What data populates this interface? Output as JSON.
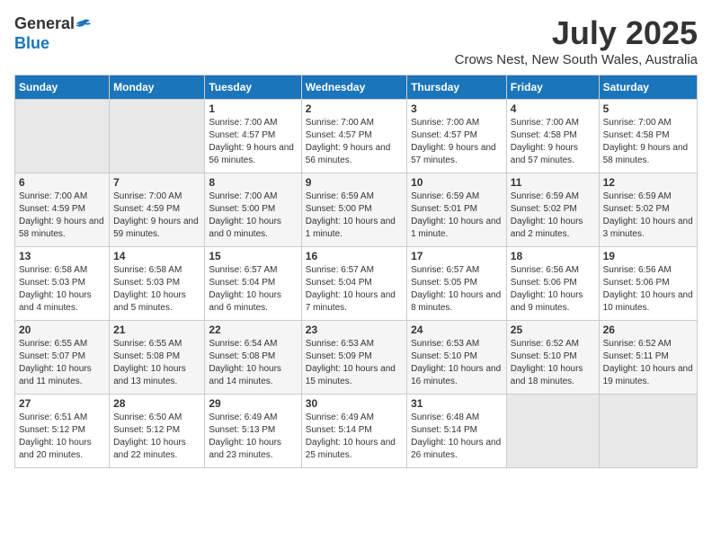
{
  "header": {
    "logo_line1": "General",
    "logo_line2": "Blue",
    "month_year": "July 2025",
    "location": "Crows Nest, New South Wales, Australia"
  },
  "days_of_week": [
    "Sunday",
    "Monday",
    "Tuesday",
    "Wednesday",
    "Thursday",
    "Friday",
    "Saturday"
  ],
  "weeks": [
    [
      {
        "day": "",
        "empty": true
      },
      {
        "day": "",
        "empty": true
      },
      {
        "day": "1",
        "sunrise": "7:00 AM",
        "sunset": "4:57 PM",
        "daylight": "9 hours and 56 minutes."
      },
      {
        "day": "2",
        "sunrise": "7:00 AM",
        "sunset": "4:57 PM",
        "daylight": "9 hours and 56 minutes."
      },
      {
        "day": "3",
        "sunrise": "7:00 AM",
        "sunset": "4:57 PM",
        "daylight": "9 hours and 57 minutes."
      },
      {
        "day": "4",
        "sunrise": "7:00 AM",
        "sunset": "4:58 PM",
        "daylight": "9 hours and 57 minutes."
      },
      {
        "day": "5",
        "sunrise": "7:00 AM",
        "sunset": "4:58 PM",
        "daylight": "9 hours and 58 minutes."
      }
    ],
    [
      {
        "day": "6",
        "sunrise": "7:00 AM",
        "sunset": "4:59 PM",
        "daylight": "9 hours and 58 minutes."
      },
      {
        "day": "7",
        "sunrise": "7:00 AM",
        "sunset": "4:59 PM",
        "daylight": "9 hours and 59 minutes."
      },
      {
        "day": "8",
        "sunrise": "7:00 AM",
        "sunset": "5:00 PM",
        "daylight": "10 hours and 0 minutes."
      },
      {
        "day": "9",
        "sunrise": "6:59 AM",
        "sunset": "5:00 PM",
        "daylight": "10 hours and 1 minute."
      },
      {
        "day": "10",
        "sunrise": "6:59 AM",
        "sunset": "5:01 PM",
        "daylight": "10 hours and 1 minute."
      },
      {
        "day": "11",
        "sunrise": "6:59 AM",
        "sunset": "5:02 PM",
        "daylight": "10 hours and 2 minutes."
      },
      {
        "day": "12",
        "sunrise": "6:59 AM",
        "sunset": "5:02 PM",
        "daylight": "10 hours and 3 minutes."
      }
    ],
    [
      {
        "day": "13",
        "sunrise": "6:58 AM",
        "sunset": "5:03 PM",
        "daylight": "10 hours and 4 minutes."
      },
      {
        "day": "14",
        "sunrise": "6:58 AM",
        "sunset": "5:03 PM",
        "daylight": "10 hours and 5 minutes."
      },
      {
        "day": "15",
        "sunrise": "6:57 AM",
        "sunset": "5:04 PM",
        "daylight": "10 hours and 6 minutes."
      },
      {
        "day": "16",
        "sunrise": "6:57 AM",
        "sunset": "5:04 PM",
        "daylight": "10 hours and 7 minutes."
      },
      {
        "day": "17",
        "sunrise": "6:57 AM",
        "sunset": "5:05 PM",
        "daylight": "10 hours and 8 minutes."
      },
      {
        "day": "18",
        "sunrise": "6:56 AM",
        "sunset": "5:06 PM",
        "daylight": "10 hours and 9 minutes."
      },
      {
        "day": "19",
        "sunrise": "6:56 AM",
        "sunset": "5:06 PM",
        "daylight": "10 hours and 10 minutes."
      }
    ],
    [
      {
        "day": "20",
        "sunrise": "6:55 AM",
        "sunset": "5:07 PM",
        "daylight": "10 hours and 11 minutes."
      },
      {
        "day": "21",
        "sunrise": "6:55 AM",
        "sunset": "5:08 PM",
        "daylight": "10 hours and 13 minutes."
      },
      {
        "day": "22",
        "sunrise": "6:54 AM",
        "sunset": "5:08 PM",
        "daylight": "10 hours and 14 minutes."
      },
      {
        "day": "23",
        "sunrise": "6:53 AM",
        "sunset": "5:09 PM",
        "daylight": "10 hours and 15 minutes."
      },
      {
        "day": "24",
        "sunrise": "6:53 AM",
        "sunset": "5:10 PM",
        "daylight": "10 hours and 16 minutes."
      },
      {
        "day": "25",
        "sunrise": "6:52 AM",
        "sunset": "5:10 PM",
        "daylight": "10 hours and 18 minutes."
      },
      {
        "day": "26",
        "sunrise": "6:52 AM",
        "sunset": "5:11 PM",
        "daylight": "10 hours and 19 minutes."
      }
    ],
    [
      {
        "day": "27",
        "sunrise": "6:51 AM",
        "sunset": "5:12 PM",
        "daylight": "10 hours and 20 minutes."
      },
      {
        "day": "28",
        "sunrise": "6:50 AM",
        "sunset": "5:12 PM",
        "daylight": "10 hours and 22 minutes."
      },
      {
        "day": "29",
        "sunrise": "6:49 AM",
        "sunset": "5:13 PM",
        "daylight": "10 hours and 23 minutes."
      },
      {
        "day": "30",
        "sunrise": "6:49 AM",
        "sunset": "5:14 PM",
        "daylight": "10 hours and 25 minutes."
      },
      {
        "day": "31",
        "sunrise": "6:48 AM",
        "sunset": "5:14 PM",
        "daylight": "10 hours and 26 minutes."
      },
      {
        "day": "",
        "empty": true
      },
      {
        "day": "",
        "empty": true
      }
    ]
  ],
  "labels": {
    "sunrise": "Sunrise:",
    "sunset": "Sunset:",
    "daylight": "Daylight:"
  }
}
